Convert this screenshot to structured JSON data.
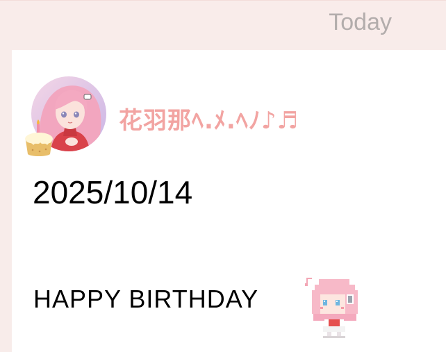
{
  "header": {
    "title": "Today"
  },
  "post": {
    "username": "花羽那ﾍ.ﾒ.ﾍﾉ♪♬",
    "date": "2025/10/14",
    "message": "HAPPY BIRTHDAY"
  },
  "colors": {
    "accent": "#f2a4a2",
    "header_bg": "#f9ecea",
    "header_text": "#b3adac"
  },
  "icons": {
    "avatar": "anime-girl-avatar",
    "badge": "birthday-cake-icon",
    "sticker": "pixel-chibi-sticker"
  }
}
